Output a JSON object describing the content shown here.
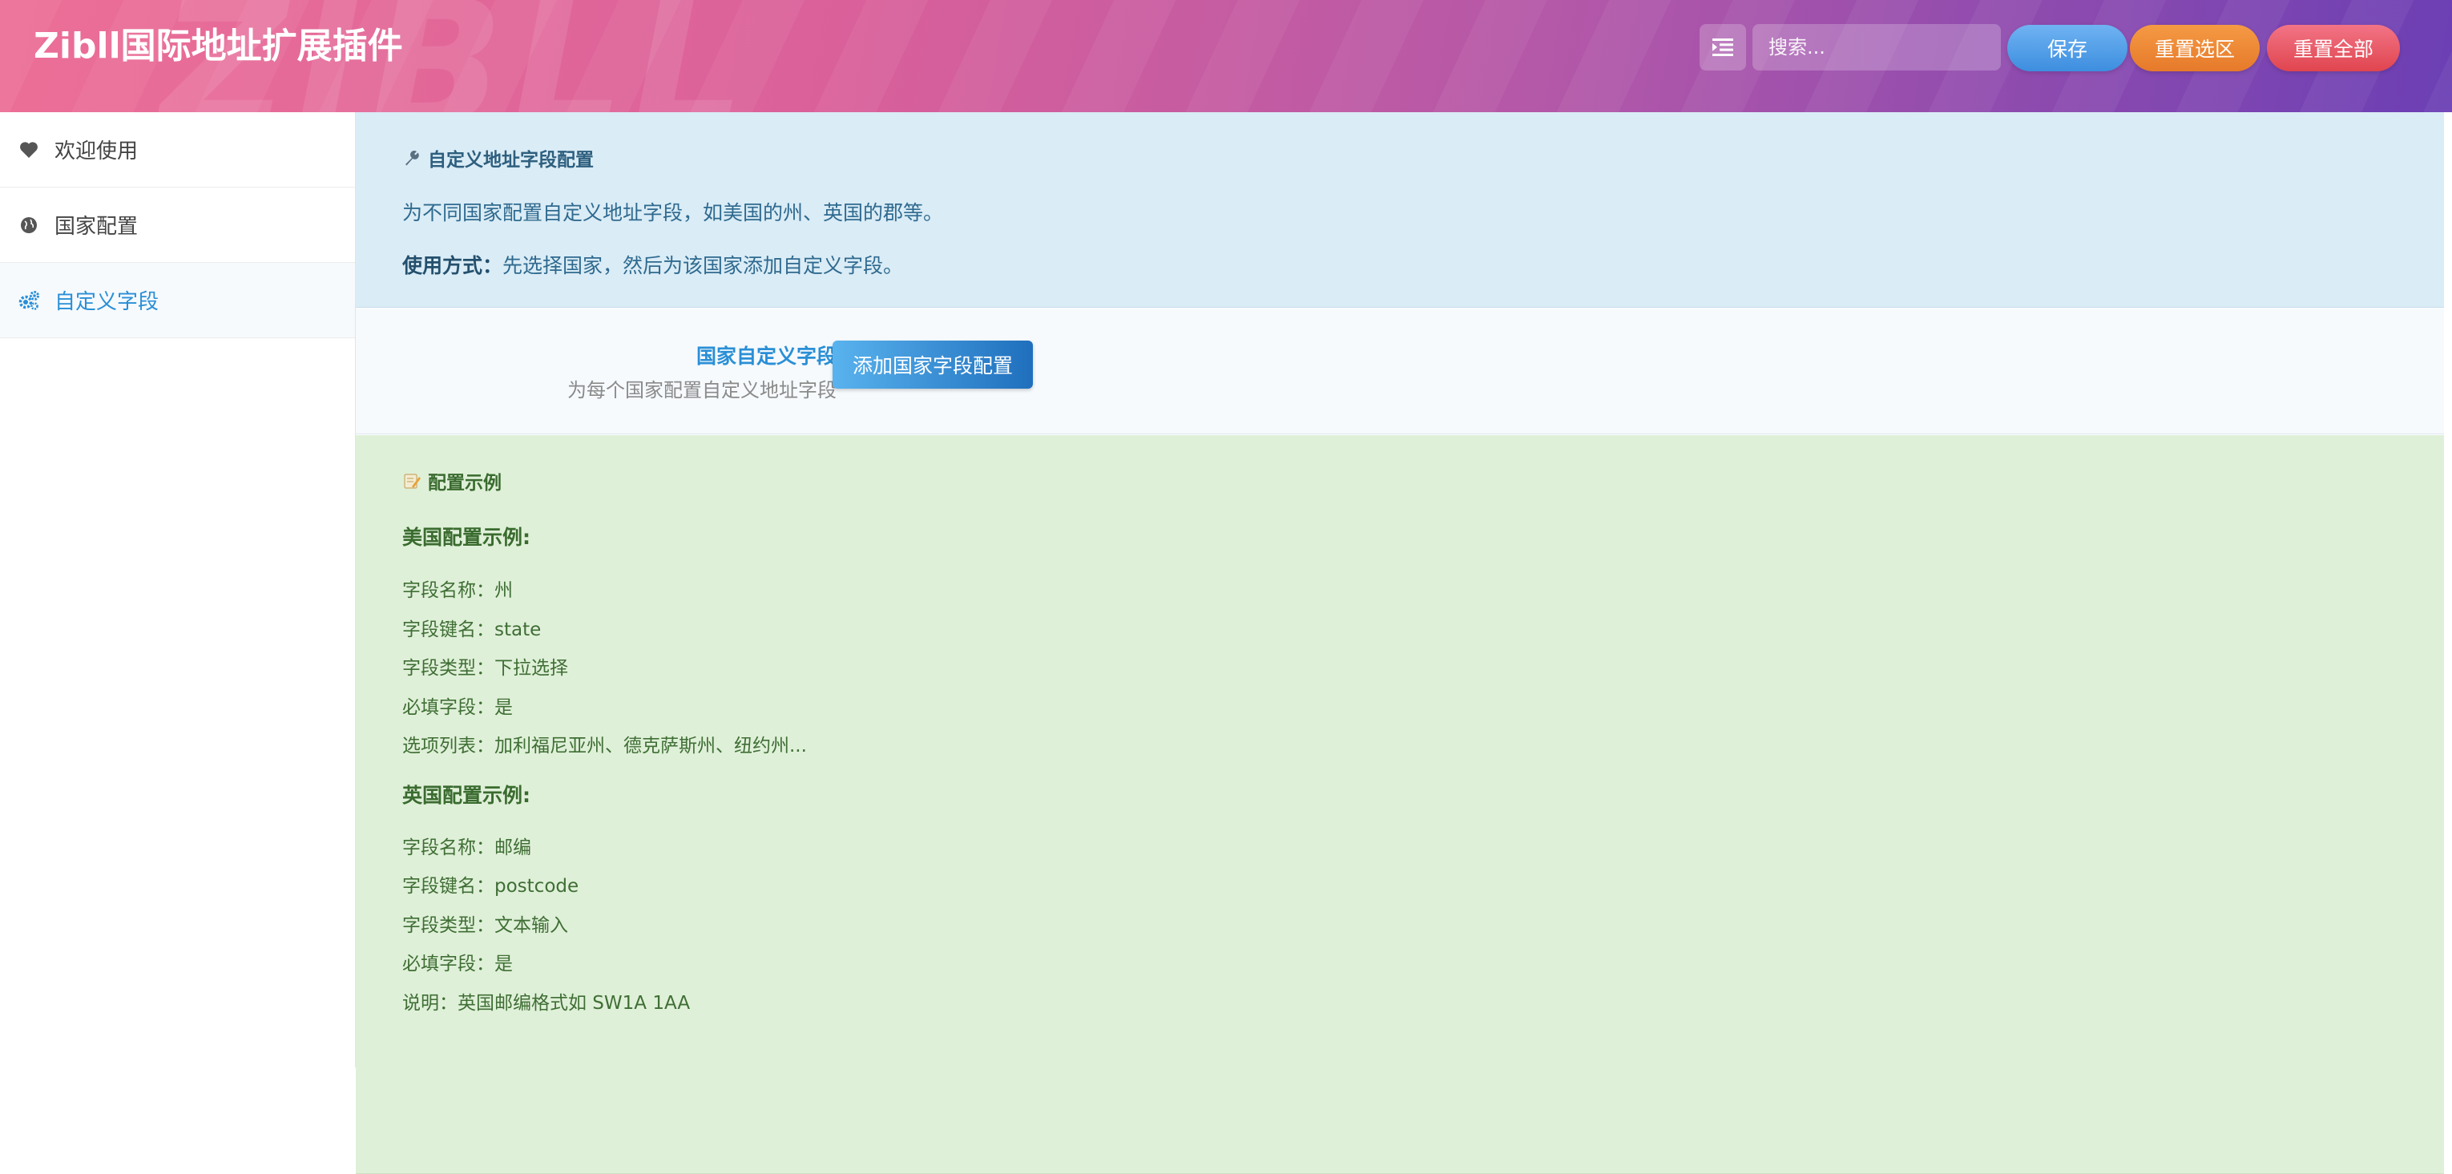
{
  "header": {
    "title": "Zibll国际地址扩展插件",
    "watermark": "ZIBLL",
    "search_placeholder": "搜索...",
    "buttons": {
      "save": "保存",
      "reset_section": "重置选区",
      "reset_all": "重置全部"
    },
    "colors": {
      "save": "#4a9de6",
      "reset_section": "#ee8a35",
      "reset_all": "#ea5a68"
    }
  },
  "sidebar": {
    "items": [
      {
        "label": "欢迎使用",
        "icon": "heart-icon"
      },
      {
        "label": "国家配置",
        "icon": "globe-icon"
      },
      {
        "label": "自定义字段",
        "icon": "gears-icon",
        "active": true
      }
    ],
    "accent_color": "#2a8fd6"
  },
  "info": {
    "title": "自定义地址字段配置",
    "description": "为不同国家配置自定义地址字段，如美国的州、英国的郡等。",
    "usage_label": "使用方式：",
    "usage_text": "先选择国家，然后为该国家添加自定义字段。"
  },
  "field": {
    "title": "国家自定义字段",
    "description": "为每个国家配置自定义地址字段",
    "add_button": "添加国家字段配置"
  },
  "examples": {
    "title": "配置示例",
    "us": {
      "heading": "美国配置示例:",
      "lines": [
        "字段名称：州",
        "字段键名：state",
        "字段类型：下拉选择",
        "必填字段：是",
        "选项列表：加利福尼亚州、德克萨斯州、纽约州..."
      ]
    },
    "uk": {
      "heading": "英国配置示例:",
      "lines": [
        "字段名称：邮编",
        "字段键名：postcode",
        "字段类型：文本输入",
        "必填字段：是",
        "说明：英国邮编格式如 SW1A 1AA"
      ]
    }
  }
}
